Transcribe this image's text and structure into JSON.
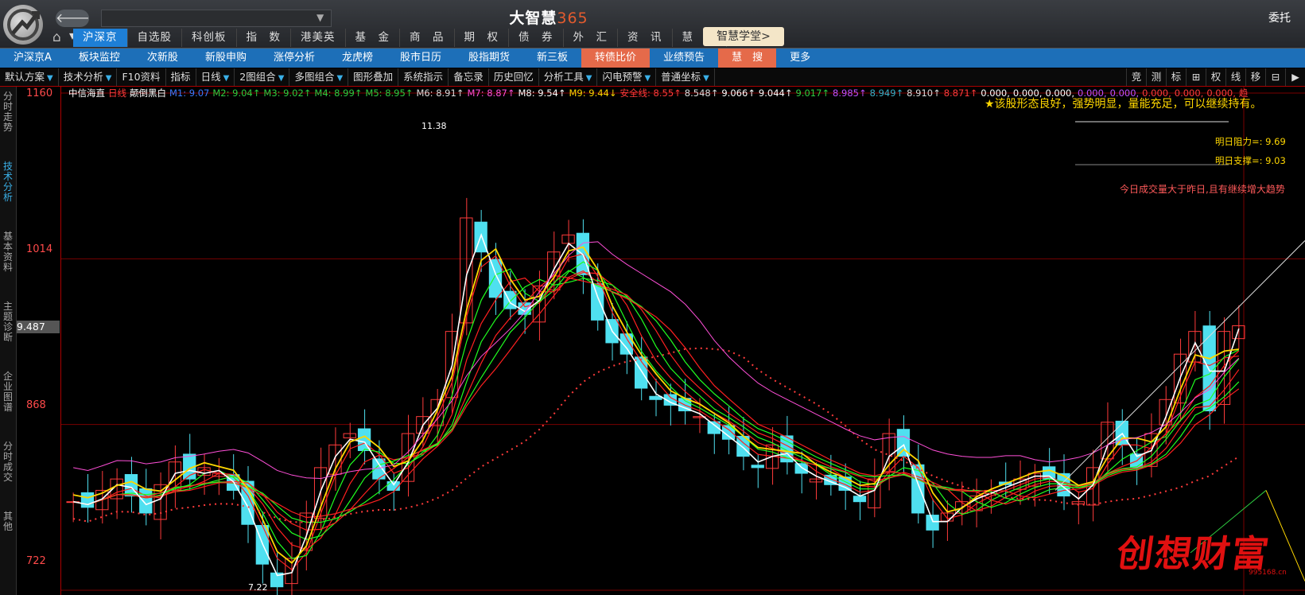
{
  "window": {
    "title_text": "大智慧",
    "title_num": "365",
    "entrust": "委托"
  },
  "nav": {
    "back": "🡐 ▾"
  },
  "menu": [
    "沪深京",
    "自选股",
    "科创板",
    "指　数",
    "港美英",
    "基　金",
    "商　品",
    "期　权",
    "债　券",
    "外　汇",
    "资　讯",
    "慧　信"
  ],
  "school": "智慧学堂>",
  "bar2": [
    "沪深京A",
    "板块监控",
    "次新股",
    "新股申购",
    "涨停分析",
    "龙虎榜",
    "股市日历",
    "股指期货",
    "新三板",
    "转债比价",
    "业绩预告",
    "慧　搜",
    "更多"
  ],
  "toolbar": [
    "默认方案",
    "技术分析",
    "F10资料",
    "指标",
    "日线",
    "2图组合",
    "多图组合",
    "图形叠加",
    "系统指示",
    "备忘录",
    "历史回忆",
    "分析工具",
    "闪电预警",
    "普通坐标"
  ],
  "toolbar_right": [
    "竞",
    "测",
    "标",
    "⊞",
    "权",
    "线",
    "移",
    "⊟",
    "▶"
  ],
  "left_tabs": [
    "分时走势",
    "技术分析",
    "基本资料",
    "主题诊断",
    "企业图谱",
    "分时成交",
    "其他"
  ],
  "axis": {
    "labels": [
      "1160",
      "1014",
      "868",
      "722"
    ],
    "current": "9.487"
  },
  "ma_line": [
    {
      "t": "中信海直",
      "c": "#ffffff"
    },
    {
      "t": "日线",
      "c": "#ff3b3b"
    },
    {
      "t": "颠倒黑白",
      "c": "#ffffff"
    },
    {
      "t": "M1: 9.07",
      "c": "#3a7bff"
    },
    {
      "t": "M2: 9.04↑",
      "c": "#2ecc40"
    },
    {
      "t": "M3: 9.02↑",
      "c": "#2ecc40"
    },
    {
      "t": "M4: 8.99↑",
      "c": "#2ecc40"
    },
    {
      "t": "M5: 8.95↑",
      "c": "#2ecc40"
    },
    {
      "t": "M6: 8.91↑",
      "c": "#dddddd"
    },
    {
      "t": "M7: 8.87↑",
      "c": "#ff4fd8"
    },
    {
      "t": "M8: 9.54↑",
      "c": "#ffffff"
    },
    {
      "t": "M9: 9.44↓",
      "c": "#ffd700"
    },
    {
      "t": "安全线: 8.55↑",
      "c": "#ff3b3b"
    },
    {
      "t": "8.548↑",
      "c": "#dddddd"
    },
    {
      "t": "9.066↑",
      "c": "#ffffff"
    },
    {
      "t": "9.044↑",
      "c": "#ffffff"
    },
    {
      "t": "9.017↑",
      "c": "#2ecc40"
    },
    {
      "t": "8.985↑",
      "c": "#c050ff"
    },
    {
      "t": "8.949↑",
      "c": "#3ab0c8"
    },
    {
      "t": "8.910↑",
      "c": "#dddddd"
    },
    {
      "t": "8.871↑",
      "c": "#ff3b3b"
    },
    {
      "t": "0.000,",
      "c": "#ffffff"
    },
    {
      "t": "0.000,",
      "c": "#ffffff"
    },
    {
      "t": "0.000,",
      "c": "#ffffff"
    },
    {
      "t": "0.000,",
      "c": "#c050ff"
    },
    {
      "t": "0.000,",
      "c": "#c050ff"
    },
    {
      "t": "0.000,",
      "c": "#ff3b3b"
    },
    {
      "t": "0.000,",
      "c": "#ff3b3b"
    },
    {
      "t": "0.000,",
      "c": "#ff3b3b"
    },
    {
      "t": "趋",
      "c": "#ff3b3b"
    }
  ],
  "annotations": {
    "advice": "★该股形态良好，强势明显，量能充足，可以继续持有。",
    "resistance": "明日阻力=: 9.69",
    "support": "明日支撑=: 9.03",
    "volume_note": "今日成交量大于昨日,且有继续增大趋势",
    "high": "11.38",
    "low": "7.22",
    "watermark": "创想财富",
    "watermark_url": "995168.cn"
  },
  "chart_data": {
    "type": "candlestick",
    "title": "中信海直 日线",
    "yaxis_labels": [
      11.6,
      10.14,
      8.68,
      7.22
    ],
    "ylim": [
      7.22,
      11.6
    ],
    "high": 11.38,
    "low": 7.22,
    "current": 9.487,
    "close": [
      8.0,
      7.95,
      8.1,
      8.2,
      8.05,
      7.9,
      8.15,
      8.35,
      8.2,
      8.3,
      8.25,
      8.1,
      7.8,
      7.45,
      7.25,
      7.5,
      7.9,
      8.3,
      8.5,
      8.6,
      8.45,
      8.2,
      8.1,
      8.6,
      8.75,
      8.9,
      9.5,
      10.5,
      10.2,
      9.8,
      9.7,
      9.65,
      9.9,
      10.2,
      10.35,
      10.0,
      9.6,
      9.4,
      9.3,
      9.0,
      8.9,
      8.85,
      8.8,
      8.75,
      8.6,
      8.55,
      8.4,
      8.3,
      8.5,
      8.35,
      8.25,
      8.2,
      8.15,
      8.1,
      8.0,
      8.2,
      8.6,
      8.4,
      7.9,
      7.75,
      7.9,
      8.0,
      8.05,
      8.1,
      8.15,
      8.2,
      8.25,
      8.2,
      8.05,
      8.0,
      8.3,
      8.7,
      8.5,
      8.3,
      8.6,
      8.9,
      9.3,
      9.5,
      8.8,
      9.5,
      9.55
    ],
    "series": [
      {
        "name": "M1",
        "color": "#3a7bff"
      },
      {
        "name": "M9",
        "color": "#ffd700"
      },
      {
        "name": "安全线",
        "color": "#ff3b3b"
      }
    ]
  },
  "colors": {
    "up": "#ff3b3b",
    "down": "#4fe0f0",
    "ma_fast": "#ffffff",
    "ma_slow": "#ffd700",
    "band_up": "#ff2020",
    "band_down": "#20ff20",
    "safety": "#ff3b3b",
    "ribbon": "#ff4fd8"
  }
}
